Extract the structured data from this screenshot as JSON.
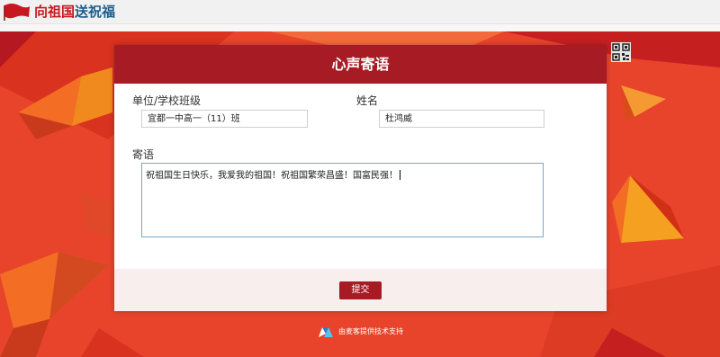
{
  "topbar": {
    "title_part1": "向祖国",
    "title_part2": "送祝福"
  },
  "card": {
    "title": "心声寄语"
  },
  "form": {
    "unit_label": "单位/学校班级",
    "unit_value": "宜都一中高一（11）班",
    "name_label": "姓名",
    "name_value": "杜鸿威",
    "message_label": "寄语",
    "message_value": "祝祖国生日快乐，我爱我的祖国！祝祖国繁荣昌盛！国富民强！",
    "submit_label": "提交"
  },
  "footer": {
    "powered_by": "由麦客提供技术支持"
  },
  "colors": {
    "header_red": "#a71c24",
    "background_red": "#e8442c",
    "title_red": "#c8171e",
    "title_blue": "#1d5d8c"
  }
}
